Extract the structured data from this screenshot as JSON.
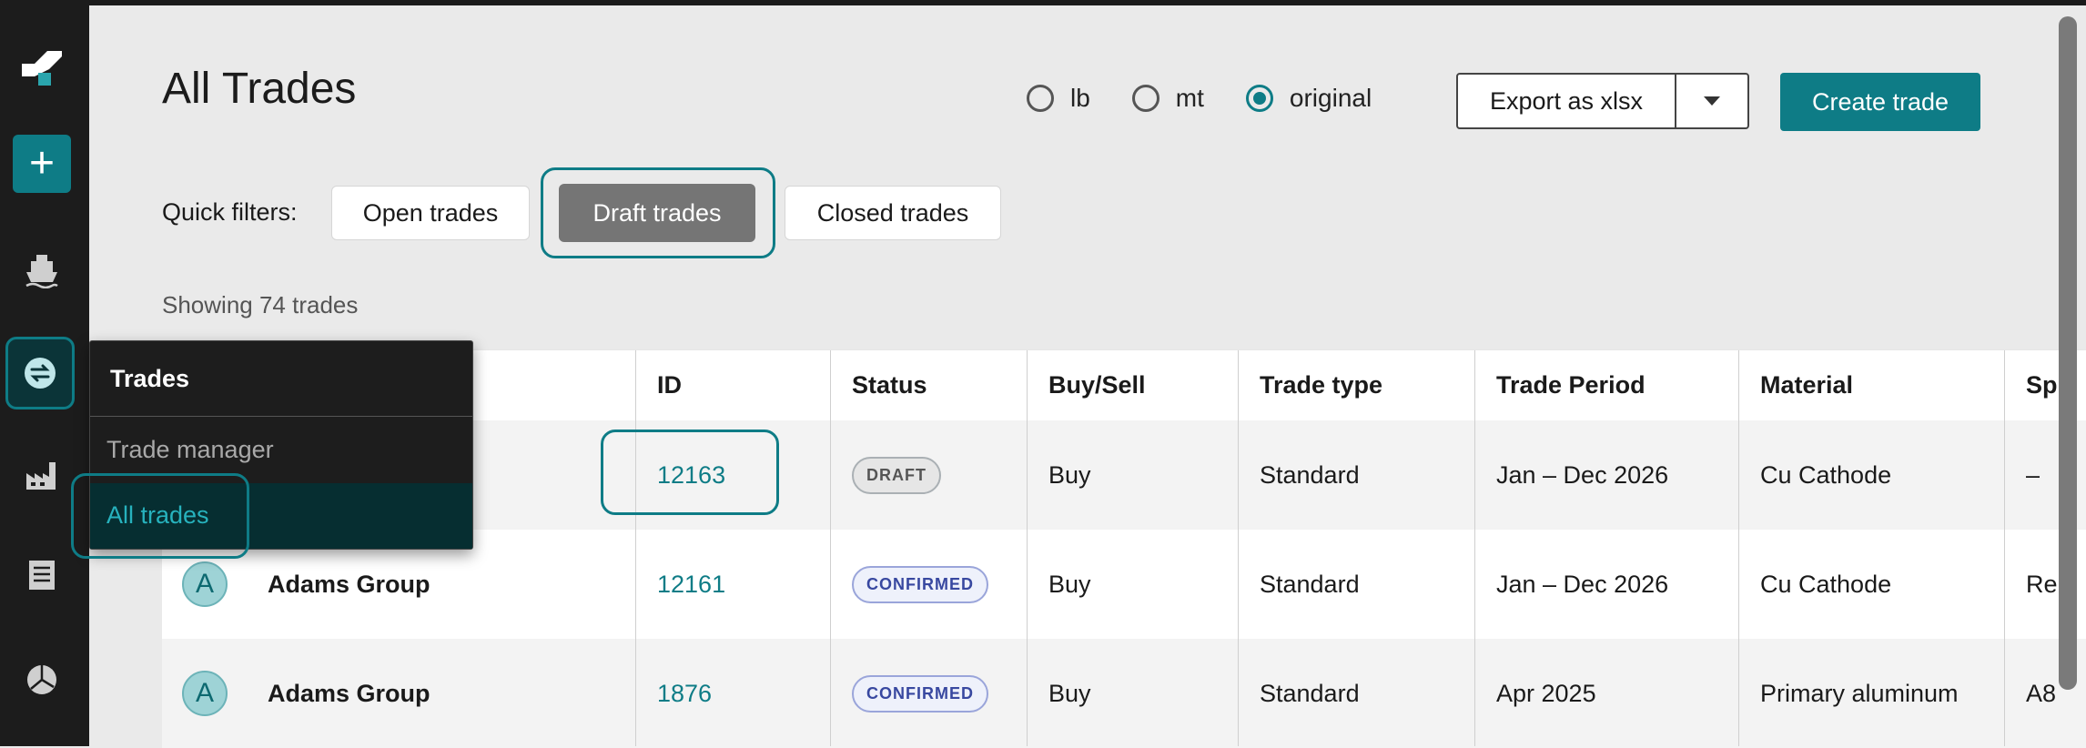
{
  "header": {
    "title": "All Trades",
    "units": [
      {
        "label": "lb",
        "selected": false
      },
      {
        "label": "mt",
        "selected": false
      },
      {
        "label": "original",
        "selected": true
      }
    ],
    "export_label": "Export as xlsx",
    "create_label": "Create trade"
  },
  "filters": {
    "label": "Quick filters:",
    "open": "Open trades",
    "draft": "Draft trades",
    "closed": "Closed trades"
  },
  "showing": "Showing 74 trades",
  "table": {
    "columns": [
      "ID",
      "Status",
      "Buy/Sell",
      "Trade type",
      "Trade Period",
      "Material",
      "Sp"
    ],
    "rows": [
      {
        "avatar": "",
        "company": "",
        "id": "12163",
        "status": "DRAFT",
        "buysell": "Buy",
        "type": "Standard",
        "period": "Jan – Dec 2026",
        "material": "Cu Cathode",
        "extra": "–"
      },
      {
        "avatar": "A",
        "company": "Adams Group",
        "id": "12161",
        "status": "CONFIRMED",
        "buysell": "Buy",
        "type": "Standard",
        "period": "Jan – Dec 2026",
        "material": "Cu Cathode",
        "extra": "Re"
      },
      {
        "avatar": "A",
        "company": "Adams Group",
        "id": "1876",
        "status": "CONFIRMED",
        "buysell": "Buy",
        "type": "Standard",
        "period": "Apr 2025",
        "material": "Primary aluminum",
        "extra": "A8"
      }
    ]
  },
  "menu": {
    "title": "Trades",
    "items": [
      "Trade manager",
      "All trades"
    ]
  },
  "colors": {
    "accent": "#0e7c86",
    "sidebar": "#1c1c1c"
  }
}
